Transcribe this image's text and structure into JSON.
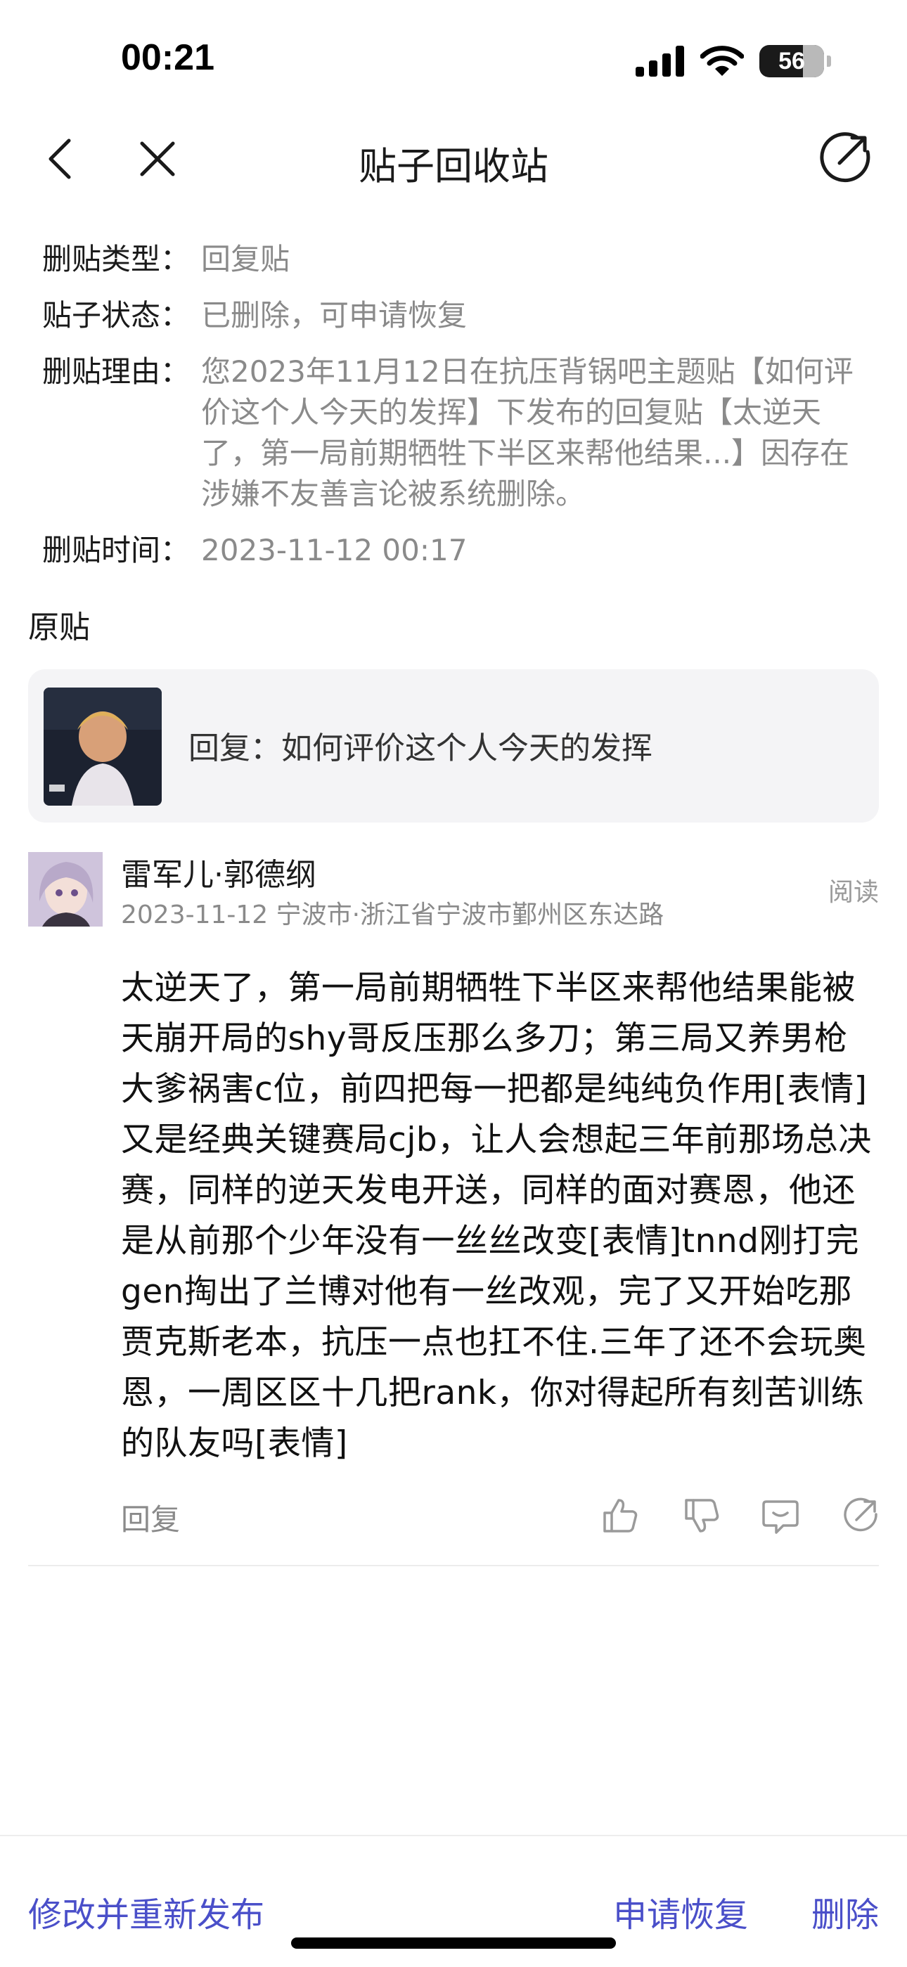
{
  "status_bar": {
    "time": "00:21",
    "battery": "56"
  },
  "nav": {
    "title": "贴子回收站"
  },
  "info": {
    "type_label": "删贴类型：",
    "type_value": "回复贴",
    "status_label": "贴子状态：",
    "status_value": "已删除，可申请恢复",
    "reason_label": "删贴理由：",
    "reason_value": "您2023年11月12日在抗压背锅吧主题贴【如何评价这个人今天的发挥】下发布的回复贴【太逆天了，第一局前期牺牲下半区来帮他结果...】因存在涉嫌不友善言论被系统删除。",
    "time_label": "删贴时间：",
    "time_value": "2023-11-12 00:17"
  },
  "original": {
    "label": "原贴",
    "reply_title": "回复：如何评价这个人今天的发挥"
  },
  "author": {
    "name": "雷军儿·郭德纲",
    "meta": "2023-11-12 宁波市·浙江省宁波市鄞州区东达路",
    "read_label": "阅读"
  },
  "post": {
    "body": " 太逆天了，第一局前期牺牲下半区来帮他结果能被天崩开局的shy哥反压那么多刀；第三局又养男枪大爹祸害c位，前四把每一把都是纯纯负作用[表情]又是经典关键赛局cjb，让人会想起三年前那场总决赛，同样的逆天发电开送，同样的面对赛恩，他还是从前那个少年没有一丝丝改变[表情]tnnd刚打完gen掏出了兰博对他有一丝改观，完了又开始吃那贾克斯老本，抗压一点也扛不住.三年了还不会玩奥恩，一周区区十几把rank，你对得起所有刻苦训练的队友吗[表情]"
  },
  "actions": {
    "reply_label": "回复"
  },
  "bottom": {
    "edit_republish": "修改并重新发布",
    "restore": "申请恢复",
    "delete": "删除"
  },
  "colors": {
    "accent": "#4a4fc9",
    "muted_text": "#8a8a8a",
    "card_bg": "#f4f4f6"
  }
}
